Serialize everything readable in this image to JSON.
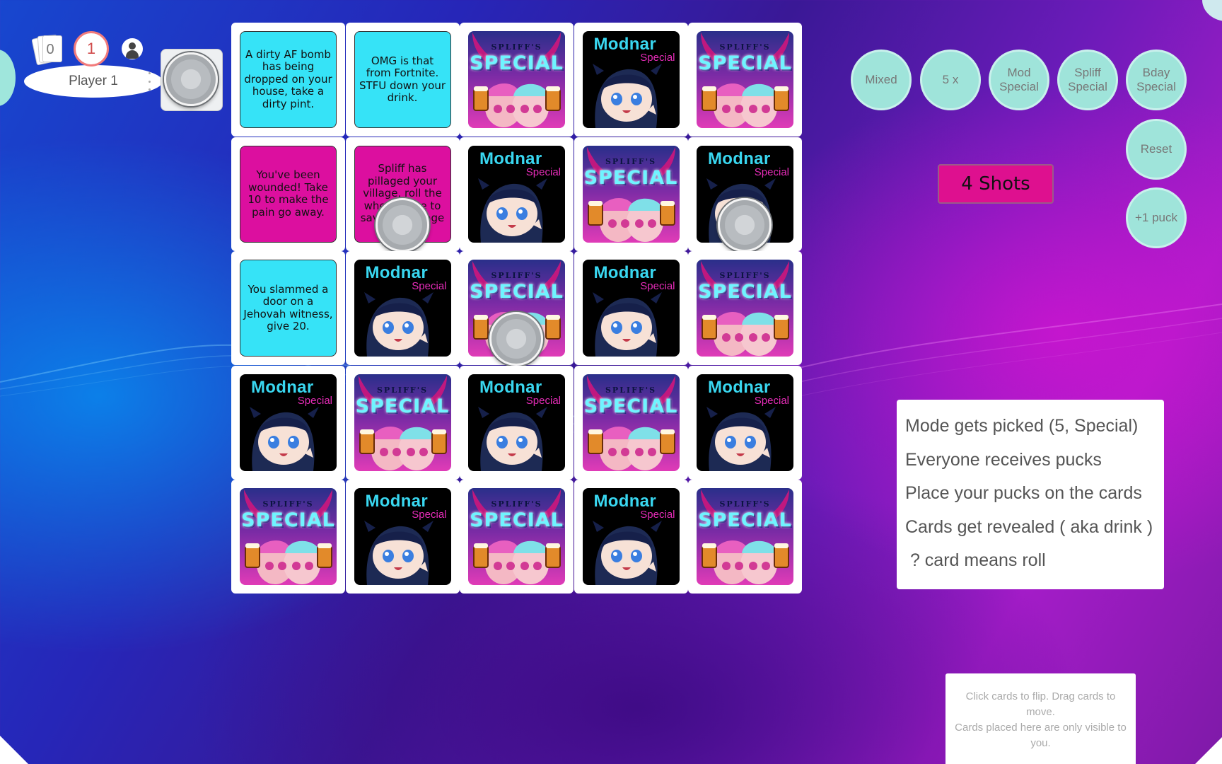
{
  "player": {
    "card_count": "0",
    "score": "1",
    "name": "Player 1"
  },
  "board": {
    "rows": [
      [
        {
          "type": "text",
          "color": "cyan",
          "text": "A dirty AF bomb has being dropped on your house, take a dirty pint."
        },
        {
          "type": "text",
          "color": "cyan",
          "text": "OMG is that from Fortnite. STFU down your drink."
        },
        {
          "type": "spliff"
        },
        {
          "type": "modnar"
        },
        {
          "type": "spliff"
        }
      ],
      [
        {
          "type": "text",
          "color": "magenta",
          "text": "You've been wounded! Take 10 to make the pain go away."
        },
        {
          "type": "text",
          "color": "magenta",
          "text": "Spliff has pillaged your village, roll the wheel twice to save the village",
          "puck": true
        },
        {
          "type": "modnar"
        },
        {
          "type": "spliff"
        },
        {
          "type": "modnar",
          "puck": true
        }
      ],
      [
        {
          "type": "text",
          "color": "cyan",
          "text": "You slammed a door on a Jehovah witness, give 20."
        },
        {
          "type": "modnar"
        },
        {
          "type": "spliff",
          "puck": true
        },
        {
          "type": "modnar"
        },
        {
          "type": "spliff"
        }
      ],
      [
        {
          "type": "modnar"
        },
        {
          "type": "spliff"
        },
        {
          "type": "modnar"
        },
        {
          "type": "spliff"
        },
        {
          "type": "modnar"
        }
      ],
      [
        {
          "type": "spliff"
        },
        {
          "type": "modnar"
        },
        {
          "type": "spliff"
        },
        {
          "type": "modnar"
        },
        {
          "type": "spliff"
        }
      ]
    ]
  },
  "card_art": {
    "modnar_title": "Modnar",
    "modnar_subtitle": "Special",
    "spliff_small": "SPLIFF'S",
    "spliff_big": "SPECIAL"
  },
  "modes": {
    "mixed": "Mixed",
    "five_x": "5 x",
    "mod_special": "Mod Special",
    "spliff_special": "Spliff Special",
    "bday_special": "Bday Special",
    "reset": "Reset",
    "plus_puck": "+1 puck"
  },
  "shots": "4 Shots",
  "instructions": [
    "Mode gets picked (5, Special)",
    "Everyone receives pucks",
    "Place your pucks on the cards",
    "Cards get revealed ( aka drink )",
    " ? card means roll"
  ],
  "hand_area": {
    "line1": "Click cards to flip.   Drag cards to move.",
    "line2": "Cards placed here are only visible to you."
  },
  "colors": {
    "cyan_card": "#36e3f7",
    "magenta_card": "#dc0f9f",
    "mode_button": "#9fe4da",
    "shots_badge": "#de108f"
  }
}
